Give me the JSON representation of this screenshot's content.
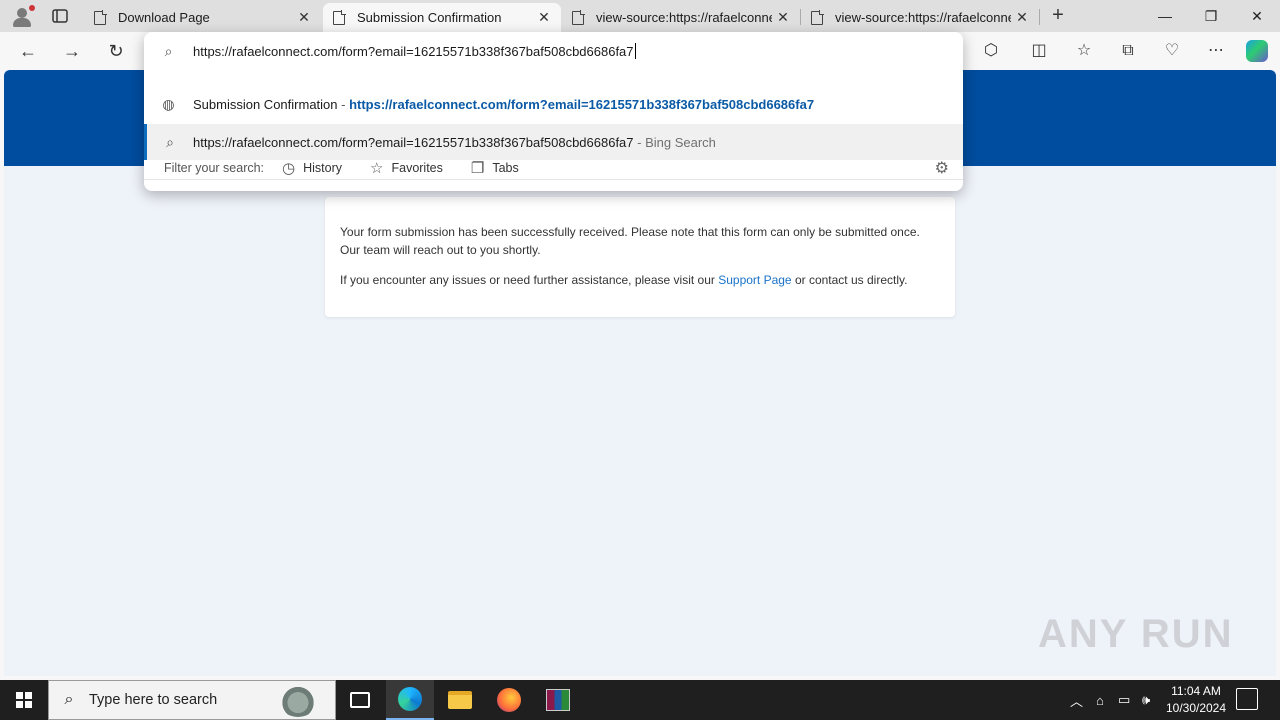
{
  "tabs": [
    {
      "title": "Download Page"
    },
    {
      "title": "Submission Confirmation"
    },
    {
      "title": "view-source:https://rafaelconnect.com"
    },
    {
      "title": "view-source:https://rafaelconnect.com"
    }
  ],
  "omnibox": {
    "input": "https://rafaelconnect.com/form?email=16215571b338f367baf508cbd6686fa7",
    "suggestion_title": "Submission Confirmation",
    "suggestion_sep": " - ",
    "suggestion_url": "https://rafaelconnect.com/form?email=16215571b338f367baf508cbd6686fa7",
    "search_query": "https://rafaelconnect.com/form?email=16215571b338f367baf508cbd6686fa7",
    "search_suffix": " - Bing Search",
    "filter_label": "Filter your search:",
    "filters": [
      "History",
      "Favorites",
      "Tabs"
    ]
  },
  "card": {
    "line1": "Your form submission has been successfully received. Please note that this form can only be submitted once. Our team will reach out to you shortly.",
    "line2_pre": "If you encounter any issues or need further assistance, please visit our ",
    "link": "Support Page",
    "line2_post": " or contact us directly."
  },
  "watermark": "ANY RUN",
  "taskbar": {
    "search_placeholder": "Type here to search",
    "time": "11:04 AM",
    "date": "10/30/2024"
  },
  "colors": {
    "banner": "#004c9e",
    "link": "#1a73c8",
    "page_bg": "#eef2f9"
  }
}
